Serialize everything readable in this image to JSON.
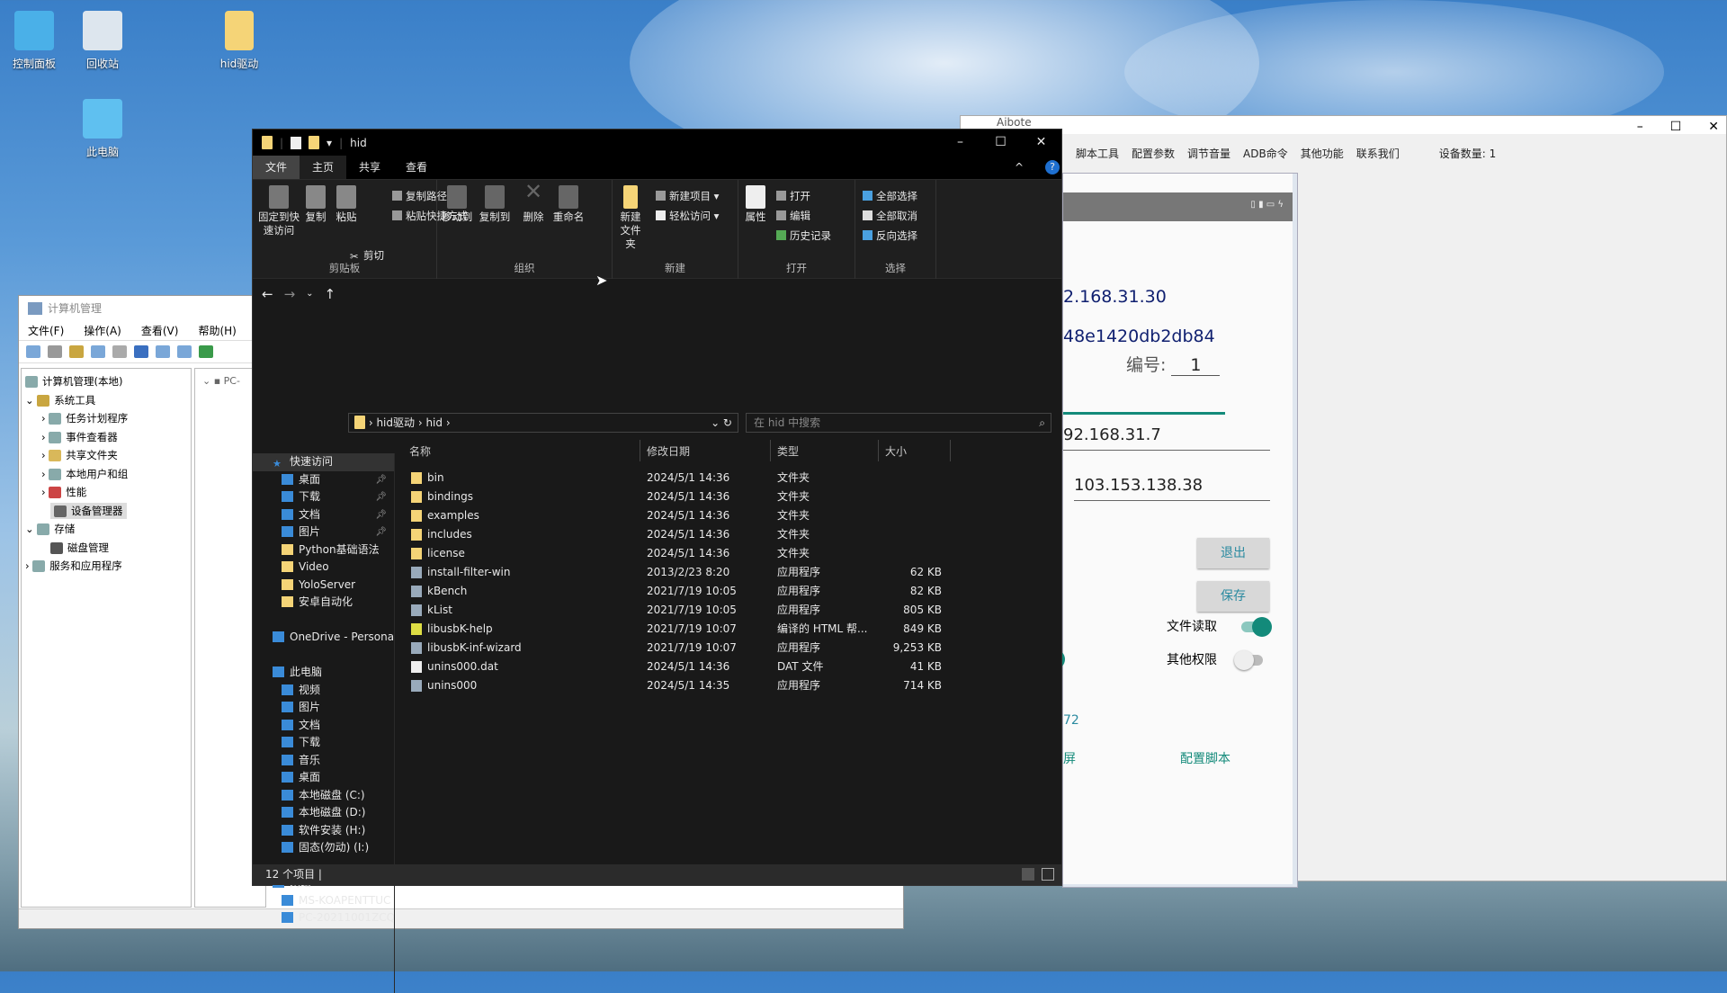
{
  "desktop": {
    "icons": [
      {
        "label": "控制面板"
      },
      {
        "label": "回收站"
      },
      {
        "label": "hid驱动"
      },
      {
        "label": "此电脑"
      }
    ]
  },
  "computer_management": {
    "title": "计算机管理",
    "menu": [
      "文件(F)",
      "操作(A)",
      "查看(V)",
      "帮助(H)"
    ],
    "tree": [
      "计算机管理(本地)",
      "系统工具",
      "任务计划程序",
      "事件查看器",
      "共享文件夹",
      "本地用户和组",
      "性能",
      "设备管理器",
      "存储",
      "磁盘管理",
      "服务和应用程序"
    ],
    "right_root": "PC-"
  },
  "aibote": {
    "title": "Aibote",
    "menu": [
      "脚本工具",
      "配置参数",
      "调节音量",
      "ADB命令",
      "其他功能",
      "联系我们"
    ],
    "device_count_label": "设备数量:",
    "device_count": "1",
    "phone": {
      "ip1": "2.168.31.30",
      "id": "48e1420db2db84",
      "number_label": "编号:",
      "number": "1",
      "ip2": "92.168.31.7",
      "ip3": "103.153.138.38",
      "exit_button": "退出",
      "save_button": "保存",
      "file_read_label": "文件读取",
      "file_read_on": true,
      "other_perm_label": "其他权限",
      "other_perm_on": false,
      "port_partial": "72",
      "partial_left": "屏",
      "config_script": "配置脚本",
      "accent": "#138a7a"
    }
  },
  "explorer": {
    "title": "hid",
    "tabs": [
      "文件",
      "主页",
      "共享",
      "查看"
    ],
    "ribbon": {
      "pin": "固定到快速访问",
      "copy": "复制",
      "paste": "粘贴",
      "copy_path": "复制路径",
      "paste_shortcut": "粘贴快捷方式",
      "cut": "剪切",
      "clipboard": "剪贴板",
      "move_to": "移动到",
      "copy_to": "复制到",
      "delete": "删除",
      "rename": "重命名",
      "organize": "组织",
      "new_folder": "新建文件夹",
      "new_item": "新建项目",
      "easy_access": "轻松访问",
      "new": "新建",
      "properties": "属性",
      "open": "打开",
      "edit": "编辑",
      "history": "历史记录",
      "open_group": "打开",
      "select_all": "全部选择",
      "select_none": "全部取消",
      "invert": "反向选择",
      "select": "选择"
    },
    "breadcrumb": [
      "hid驱动",
      "hid"
    ],
    "search_placeholder": "在 hid 中搜索",
    "nav": [
      {
        "label": "快速访问",
        "type": "star"
      },
      {
        "label": "桌面",
        "pin": true
      },
      {
        "label": "下载",
        "pin": true
      },
      {
        "label": "文档",
        "pin": true
      },
      {
        "label": "图片",
        "pin": true
      },
      {
        "label": "Python基础语法"
      },
      {
        "label": "Video"
      },
      {
        "label": "YoloServer"
      },
      {
        "label": "安卓自动化"
      },
      {
        "label": ""
      },
      {
        "label": "OneDrive - Persona"
      },
      {
        "label": ""
      },
      {
        "label": "此电脑"
      },
      {
        "label": "视频"
      },
      {
        "label": "图片"
      },
      {
        "label": "文档"
      },
      {
        "label": "下载"
      },
      {
        "label": "音乐"
      },
      {
        "label": "桌面"
      },
      {
        "label": "本地磁盘 (C:)"
      },
      {
        "label": "本地磁盘 (D:)"
      },
      {
        "label": "软件安装 (H:)"
      },
      {
        "label": "固态(勿动) (I:)"
      },
      {
        "label": ""
      },
      {
        "label": "网络"
      },
      {
        "label": "MS-KOAPENTTUC"
      },
      {
        "label": "PC-20211001ZCQ"
      }
    ],
    "columns": [
      "名称",
      "修改日期",
      "类型",
      "大小"
    ],
    "files": [
      {
        "name": "bin",
        "date": "2024/5/1 14:36",
        "type": "文件夹",
        "size": "",
        "icon": "folder"
      },
      {
        "name": "bindings",
        "date": "2024/5/1 14:36",
        "type": "文件夹",
        "size": "",
        "icon": "folder"
      },
      {
        "name": "examples",
        "date": "2024/5/1 14:36",
        "type": "文件夹",
        "size": "",
        "icon": "folder"
      },
      {
        "name": "includes",
        "date": "2024/5/1 14:36",
        "type": "文件夹",
        "size": "",
        "icon": "folder"
      },
      {
        "name": "license",
        "date": "2024/5/1 14:36",
        "type": "文件夹",
        "size": "",
        "icon": "folder"
      },
      {
        "name": "install-filter-win",
        "date": "2013/2/23 8:20",
        "type": "应用程序",
        "size": "62 KB",
        "icon": "exe"
      },
      {
        "name": "kBench",
        "date": "2021/7/19 10:05",
        "type": "应用程序",
        "size": "82 KB",
        "icon": "exe"
      },
      {
        "name": "kList",
        "date": "2021/7/19 10:05",
        "type": "应用程序",
        "size": "805 KB",
        "icon": "exe"
      },
      {
        "name": "libusbK-help",
        "date": "2021/7/19 10:07",
        "type": "编译的 HTML 帮...",
        "size": "849 KB",
        "icon": "chm"
      },
      {
        "name": "libusbK-inf-wizard",
        "date": "2021/7/19 10:07",
        "type": "应用程序",
        "size": "9,253 KB",
        "icon": "exe"
      },
      {
        "name": "unins000.dat",
        "date": "2024/5/1 14:36",
        "type": "DAT 文件",
        "size": "41 KB",
        "icon": "file"
      },
      {
        "name": "unins000",
        "date": "2024/5/1 14:35",
        "type": "应用程序",
        "size": "714 KB",
        "icon": "exe"
      }
    ],
    "status": "12 个项目"
  }
}
